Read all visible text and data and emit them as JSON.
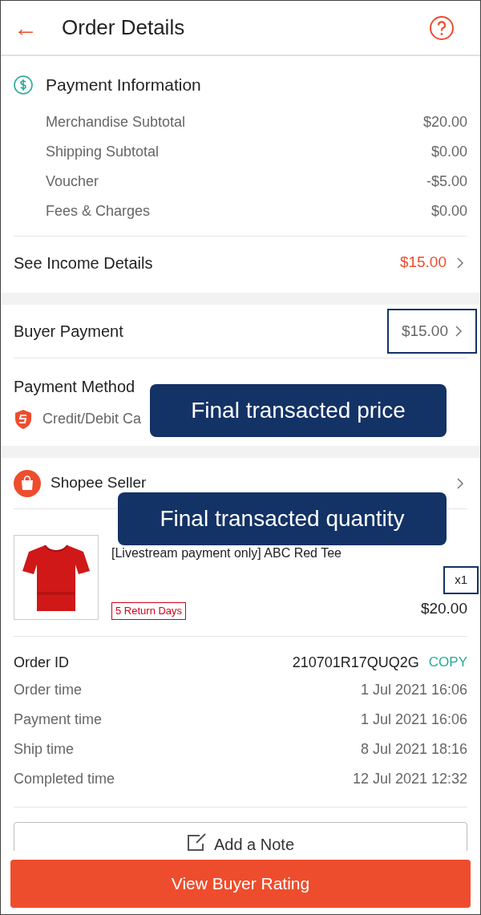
{
  "header": {
    "back": "←",
    "title": "Order Details"
  },
  "payment_information": {
    "title": "Payment Information",
    "rows": [
      {
        "label": "Merchandise Subtotal",
        "value": "$20.00"
      },
      {
        "label": "Shipping Subtotal",
        "value": "$0.00"
      },
      {
        "label": "Voucher",
        "value": "-$5.00"
      },
      {
        "label": "Fees & Charges",
        "value": "$0.00"
      }
    ],
    "income": {
      "label": "See Income Details",
      "value": "$15.00"
    }
  },
  "buyer_payment": {
    "label": "Buyer Payment",
    "value": "$15.00",
    "highlighted": true
  },
  "payment_method": {
    "label": "Payment Method",
    "value": "Credit/Debit Ca"
  },
  "seller": {
    "name": "Shopee Seller"
  },
  "product": {
    "kind": "picture",
    "name": "[Livestream payment only] ABC Red Tee",
    "quantity": "x1",
    "quantity_highlighted": true,
    "return_badge": "5 Return Days",
    "price": "$20.00"
  },
  "order": {
    "id_label": "Order ID",
    "id": "210701R17QUQ2G",
    "copy": "COPY",
    "rows": [
      {
        "label": "Order time",
        "value": "1 Jul 2021 16:06"
      },
      {
        "label": "Payment time",
        "value": "1 Jul 2021 16:06"
      },
      {
        "label": "Ship time",
        "value": "8 Jul 2021 18:16"
      },
      {
        "label": "Completed time",
        "value": "12 Jul 2021 12:32"
      }
    ]
  },
  "note_button": "Add a Note",
  "rating_button": "View Buyer Rating",
  "callouts": [
    "Final transacted price",
    "Final transacted quantity"
  ]
}
